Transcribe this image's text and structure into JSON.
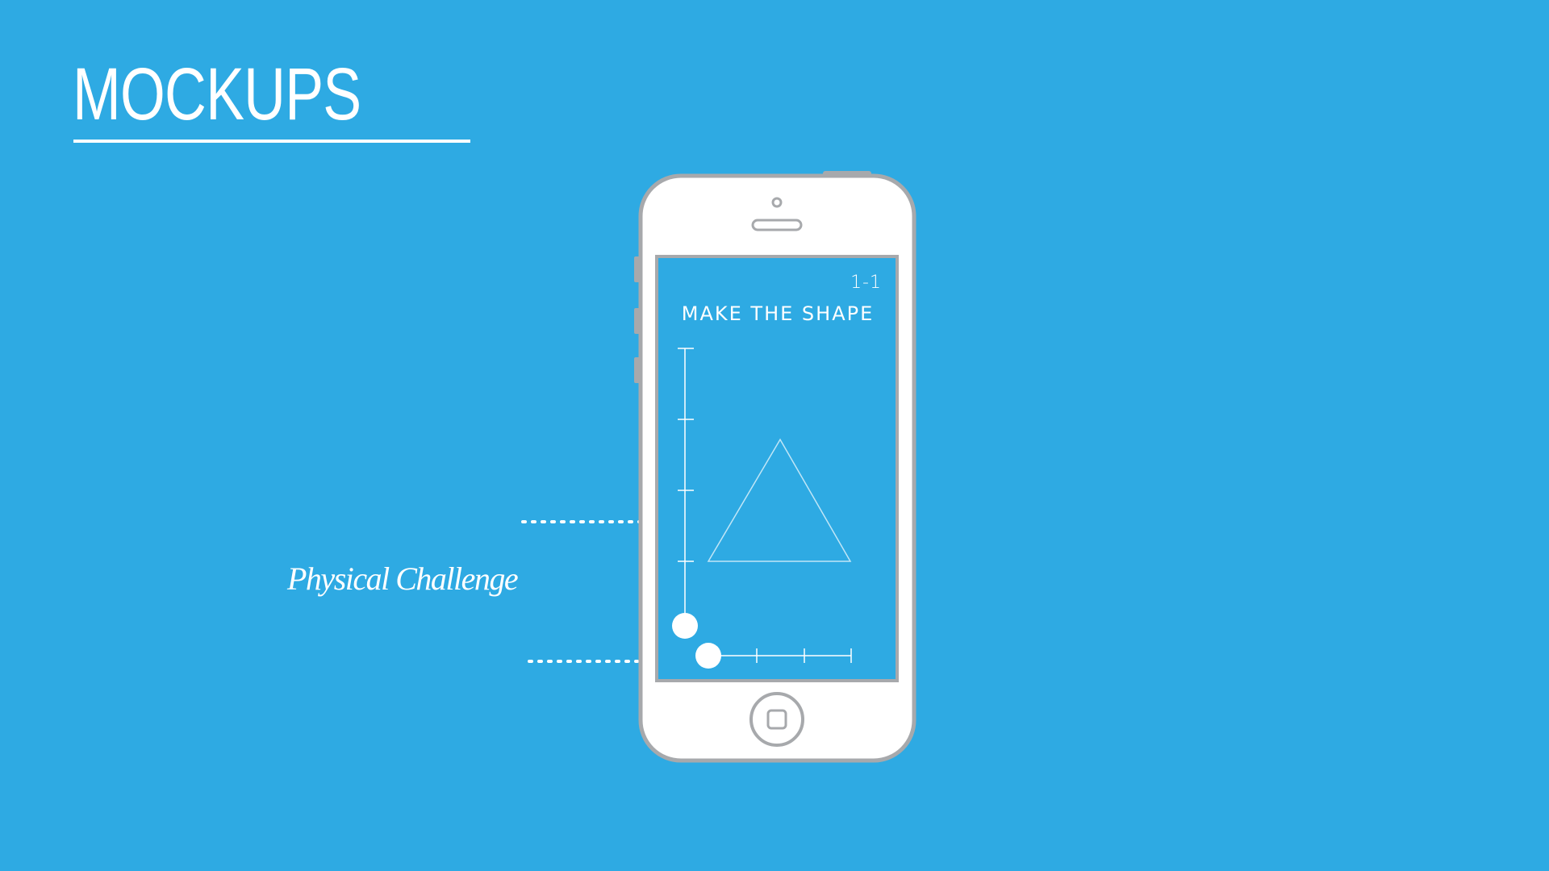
{
  "slide": {
    "title": "MOCKUPS",
    "callout_label": "Physical Challenge"
  },
  "phone_screen": {
    "level": "1-1",
    "challenge_title": "MAKE THE SHAPE",
    "target_shape": "triangle",
    "vertical_slider_value": 0,
    "horizontal_slider_value": 0
  },
  "colors": {
    "background": "#2eaae3",
    "screen": "#2eaae3",
    "phone_body": "#ffffff",
    "phone_outline": "#a7a9ac",
    "foreground": "#ffffff"
  },
  "icons": {
    "home_button": "home-button-icon",
    "camera": "front-camera-icon",
    "speaker": "earpiece-speaker-icon"
  }
}
